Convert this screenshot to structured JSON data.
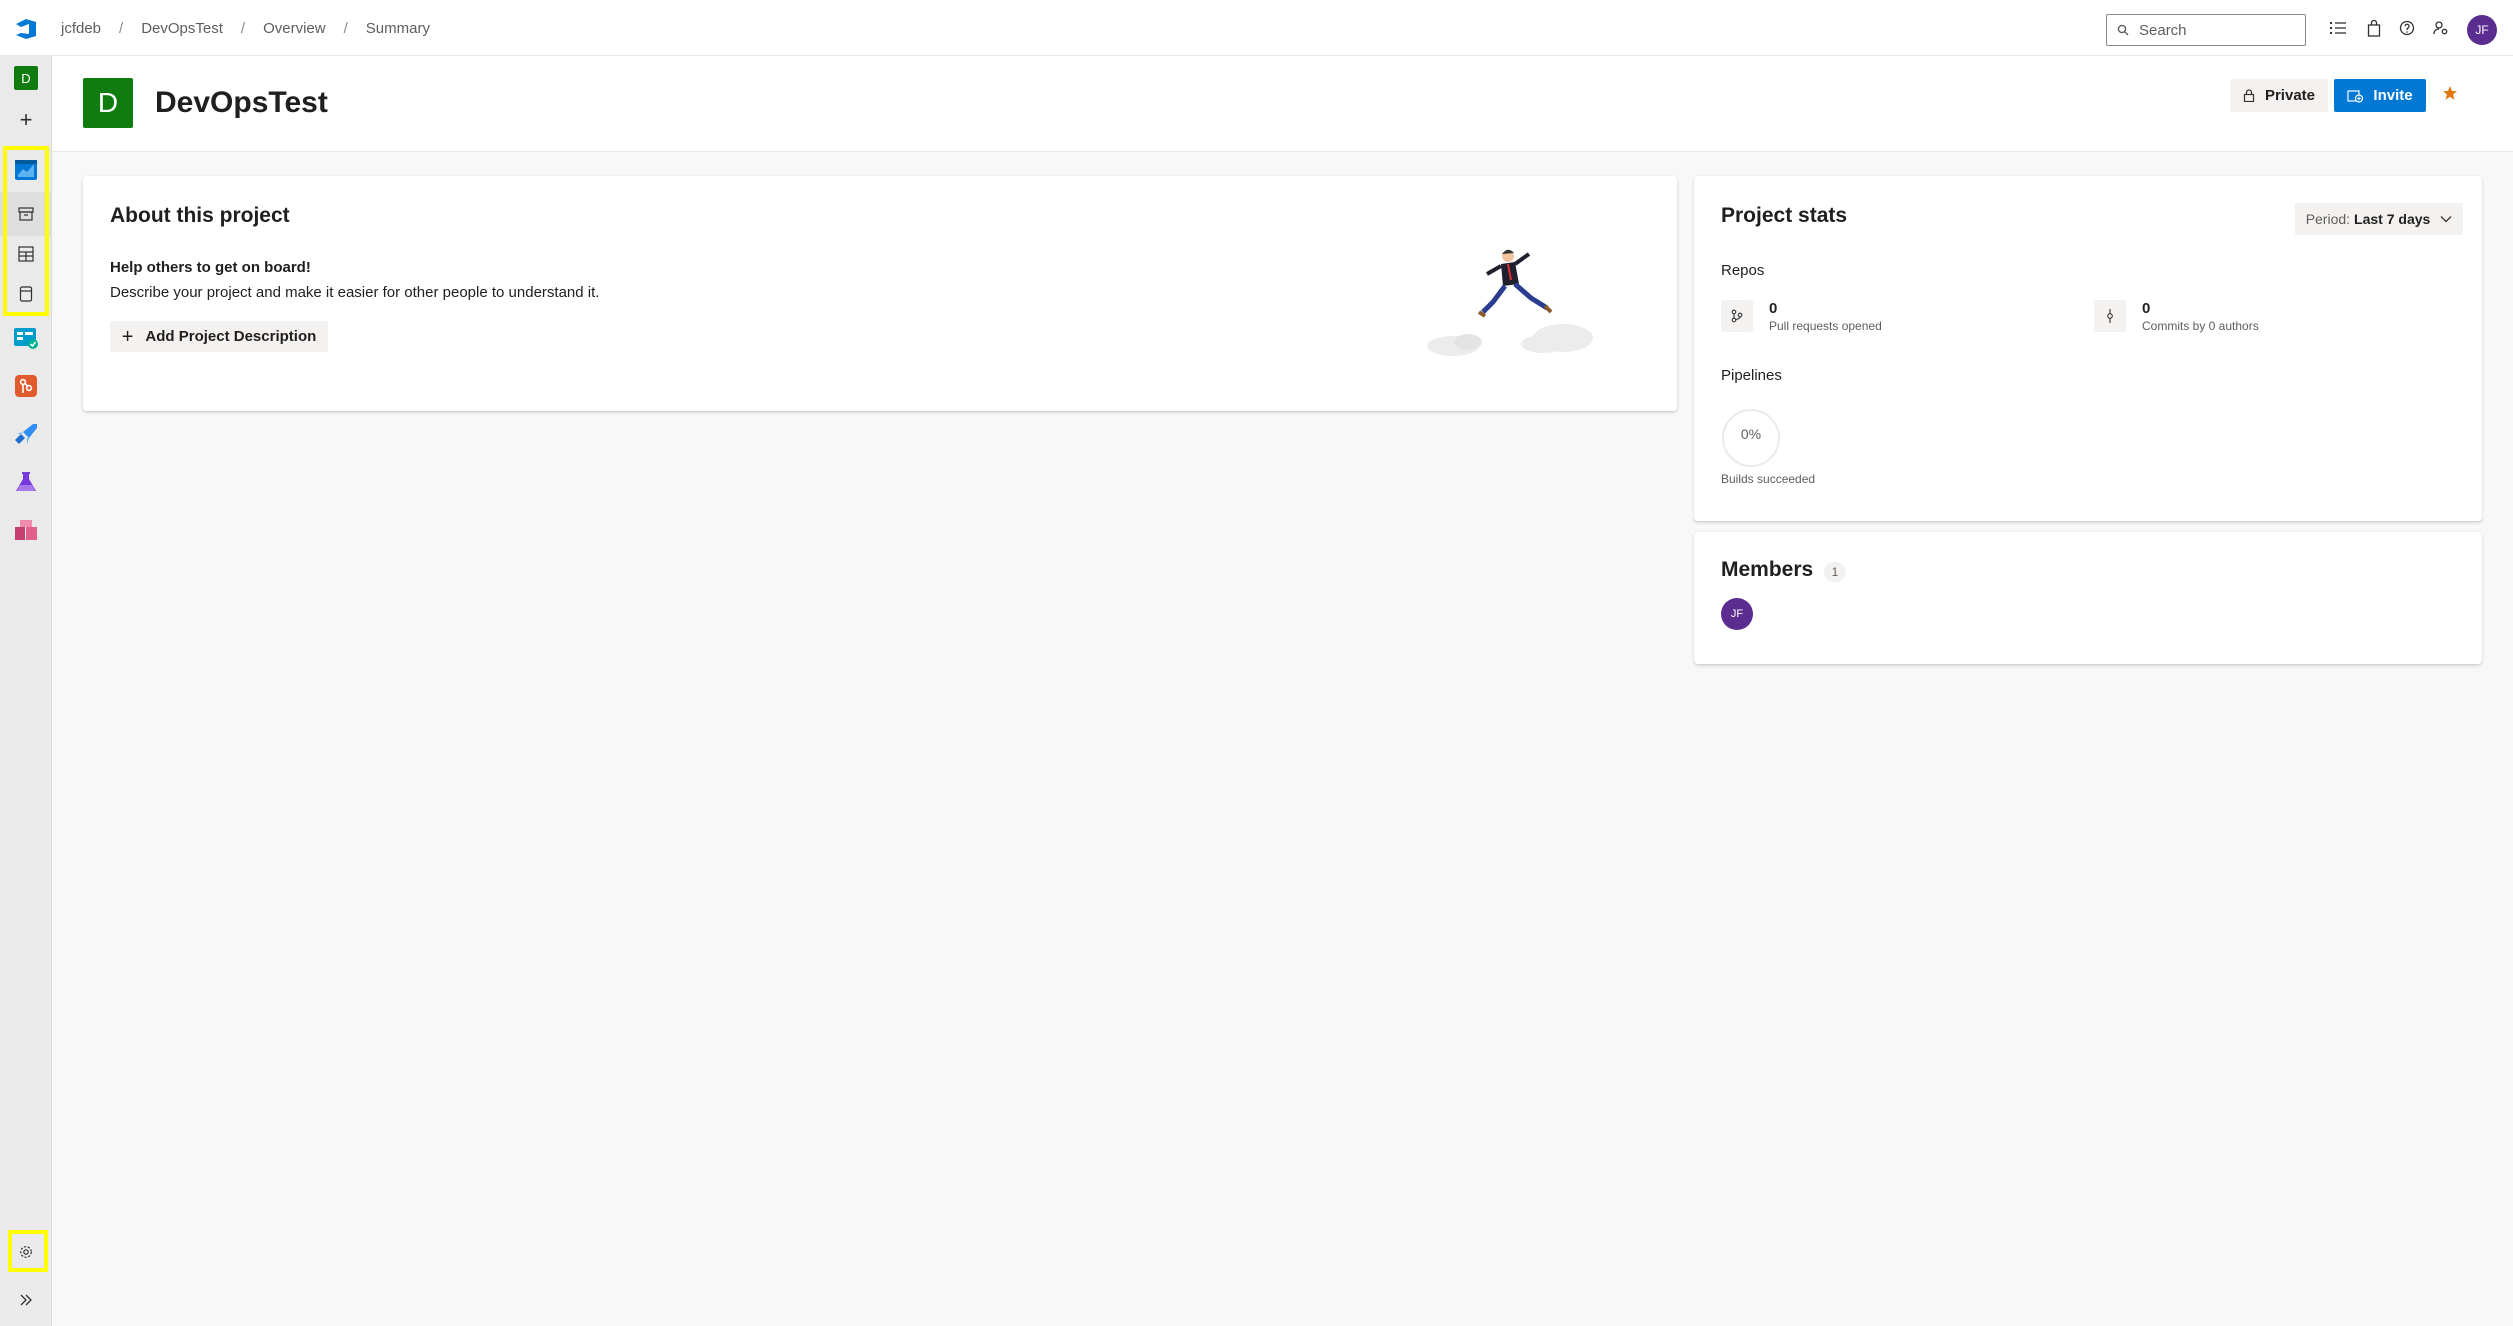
{
  "breadcrumb": {
    "org": "jcfdeb",
    "project": "DevOpsTest",
    "section": "Overview",
    "page": "Summary",
    "separator": "/"
  },
  "topbar": {
    "search_placeholder": "Search",
    "user_initials": "JF",
    "icons": [
      "azure-devops-logo",
      "task-list-icon",
      "shopping-bag-icon",
      "help-icon",
      "user-settings-icon"
    ]
  },
  "leftnav": {
    "project_initial": "D",
    "new_label": "+",
    "items": [
      "overview",
      "summary",
      "dashboards",
      "wiki",
      "boards",
      "repos",
      "pipelines",
      "test-plans",
      "artifacts"
    ],
    "settings_icon": "gear-icon",
    "expand_icon": "double-chevron-right-icon"
  },
  "header": {
    "project_initial": "D",
    "project_name": "DevOpsTest",
    "private_label": "Private",
    "invite_label": "Invite"
  },
  "about": {
    "title": "About this project",
    "help_title": "Help others to get on board!",
    "help_text": "Describe your project and make it easier for other people to understand it.",
    "add_description_label": "Add Project Description"
  },
  "stats": {
    "title": "Project stats",
    "period_label": "Period:",
    "period_value": "Last 7 days",
    "repos_label": "Repos",
    "pull_requests_count": "0",
    "pull_requests_label": "Pull requests opened",
    "commits_count": "0",
    "commits_label": "Commits by 0 authors",
    "pipelines_label": "Pipelines",
    "builds_percent": "0%",
    "builds_label": "Builds succeeded"
  },
  "members": {
    "title": "Members",
    "count": "1",
    "list": [
      {
        "initials": "JF"
      }
    ]
  },
  "colors": {
    "accent": "#0078d4",
    "project_green": "#107c10",
    "avatar_purple": "#5c2d91",
    "highlight": "#ffff00",
    "star": "#e3760b"
  }
}
